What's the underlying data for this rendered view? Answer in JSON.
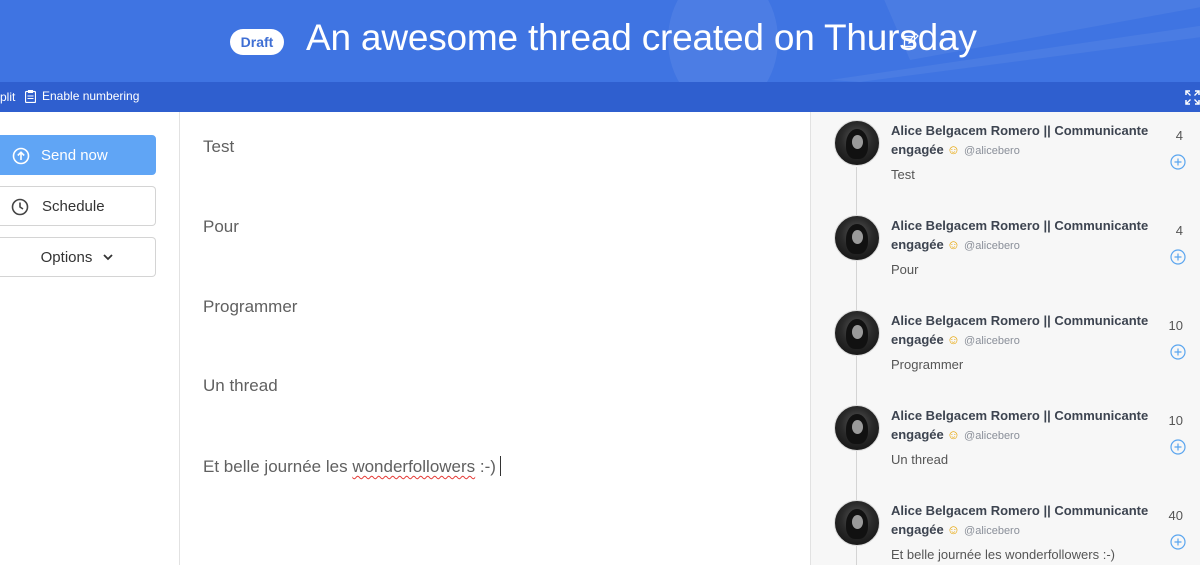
{
  "header": {
    "badge": "Draft",
    "title": "An awesome thread created on Thursday",
    "accent_color": "#3f74e2"
  },
  "toolbar": {
    "split_label": "plit",
    "numbering_label": "Enable numbering"
  },
  "actions": {
    "send_now": "Send now",
    "schedule": "Schedule",
    "options": "Options"
  },
  "editor": {
    "tweets": [
      "Test",
      "Pour",
      "Programmer",
      "Un thread"
    ],
    "last_prefix": "Et belle journée les ",
    "last_misspelled": "wonderfollowers",
    "last_suffix": " :-)"
  },
  "preview": {
    "author": "Alice Belgacem Romero || Communicante engagée",
    "handle": "@alicebero",
    "tweets": [
      {
        "text": "Test",
        "count": "4"
      },
      {
        "text": "Pour",
        "count": "4"
      },
      {
        "text": "Programmer",
        "count": "10"
      },
      {
        "text": "Un thread",
        "count": "10"
      },
      {
        "text": "Et belle journée les wonderfollowers :-)",
        "count": "40"
      }
    ]
  }
}
